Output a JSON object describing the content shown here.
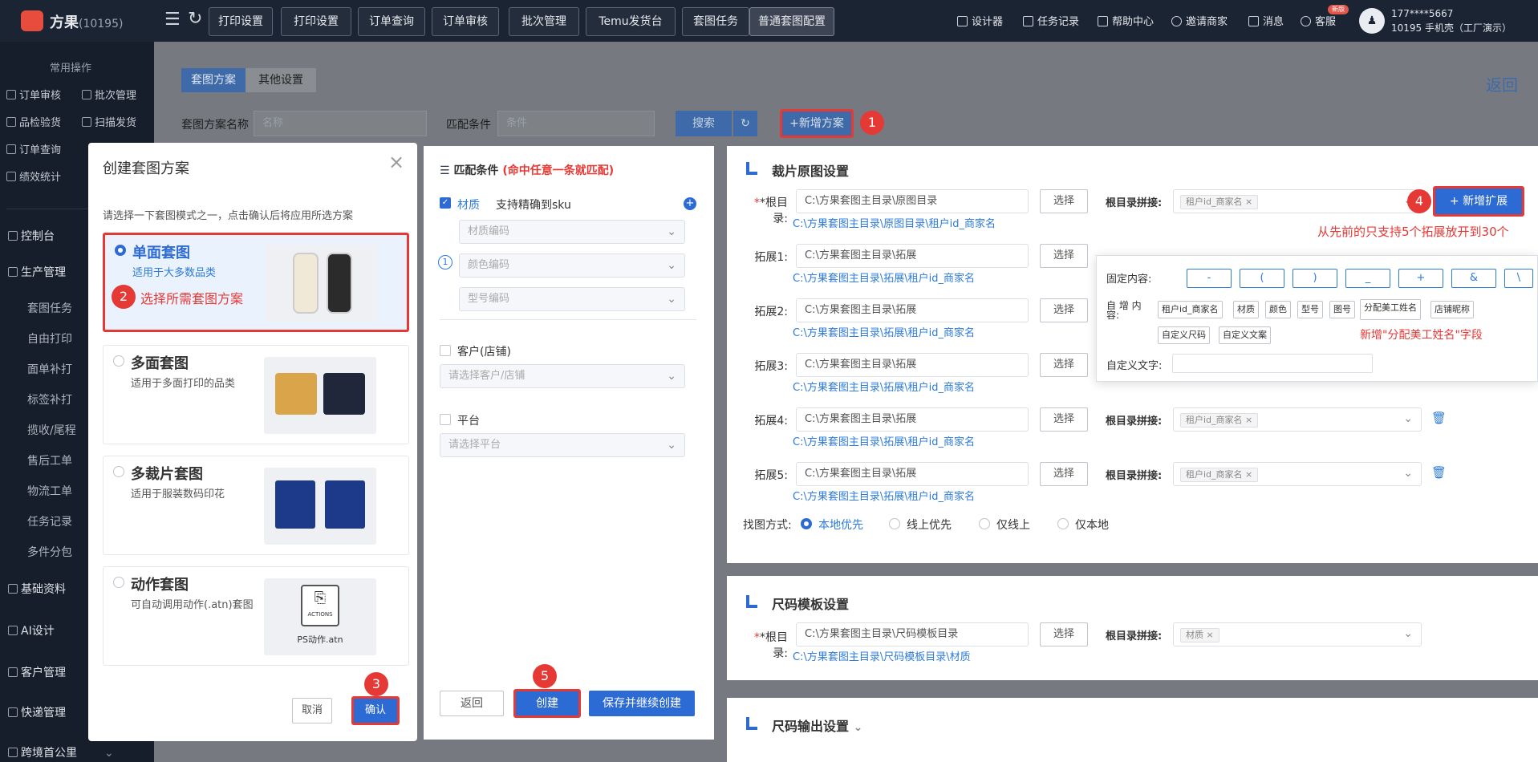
{
  "topbar": {
    "brand": "方果",
    "brand_id": "(10195)",
    "tabs": [
      "打印设置",
      "打印设置",
      "订单查询",
      "订单审核",
      "批次管理",
      "Temu发货台",
      "套图任务",
      "普通套图配置"
    ],
    "right": [
      "设计器",
      "任务记录",
      "帮助中心",
      "邀请商家",
      "消息",
      "客服"
    ],
    "badge": "新版",
    "user_phone": "177****5667",
    "user_sub": "10195 手机壳（工厂演示）"
  },
  "sidebar": {
    "common_header": "常用操作",
    "quick": [
      "订单审核",
      "批次管理",
      "品检验货",
      "扫描发货",
      "订单查询",
      "",
      "绩效统计",
      ""
    ],
    "menu": [
      "控制台",
      "生产管理",
      "基础资料",
      "AI设计",
      "客户管理",
      "快递管理",
      "跨境首公里"
    ],
    "sub": [
      "套图任务",
      "自由打印",
      "面单补打",
      "标签补打",
      "揽收/尾程",
      "售后工单",
      "物流工单",
      "任务记录",
      "多件分包"
    ]
  },
  "main": {
    "tab_scheme": "套图方案",
    "tab_other": "其他设置",
    "back": "返回",
    "name_label": "套图方案名称",
    "name_placeholder": "名称",
    "cond_label": "匹配条件",
    "cond_placeholder": "条件",
    "search": "搜索",
    "add_scheme": "+新增方案"
  },
  "match": {
    "title": "匹配条件",
    "note": "(命中任意一条就匹配)",
    "material": "材质",
    "sku": "支持精确到sku",
    "material_code": "材质编码",
    "color_code": "颜色编码",
    "model_code": "型号编码",
    "customer": "客户(店铺)",
    "customer_ph": "请选择客户/店铺",
    "platform": "平台",
    "platform_ph": "请选择平台",
    "back": "返回",
    "create": "创建",
    "save_continue": "保存并继续创建"
  },
  "crop": {
    "title": "裁片原图设置",
    "root_label": "*根目录:",
    "root_value": "C:\\方果套图主目录\\原图目录",
    "root_path": "C:\\方果套图主目录\\原图目录\\租户id_商家名",
    "select": "选择",
    "splice_label": "根目录拼接:",
    "tag": "租户id_商家名",
    "add_ext": "+ 新增扩展",
    "ext_note": "从先前的只支持5个拓展放开到30个",
    "exts": [
      {
        "label": "拓展1:",
        "value": "C:\\方果套图主目录\\拓展",
        "path": "C:\\方果套图主目录\\拓展\\租户id_商家名"
      },
      {
        "label": "拓展2:",
        "value": "C:\\方果套图主目录\\拓展",
        "path": "C:\\方果套图主目录\\拓展\\租户id_商家名"
      },
      {
        "label": "拓展3:",
        "value": "C:\\方果套图主目录\\拓展",
        "path": "C:\\方果套图主目录\\拓展\\租户id_商家名"
      },
      {
        "label": "拓展4:",
        "value": "C:\\方果套图主目录\\拓展",
        "path": "C:\\方果套图主目录\\拓展\\租户id_商家名"
      },
      {
        "label": "拓展5:",
        "value": "C:\\方果套图主目录\\拓展",
        "path": "C:\\方果套图主目录\\拓展\\租户id_商家名"
      }
    ],
    "find_label": "找图方式:",
    "find_opts": [
      "本地优先",
      "线上优先",
      "仅线上",
      "仅本地"
    ]
  },
  "popover": {
    "fixed_label": "固定内容:",
    "fixed": [
      "-",
      "(",
      ")",
      "_",
      "+",
      "&",
      "\\"
    ],
    "auto_label": "自 增 内 容:",
    "auto": [
      "租户id_商家名",
      "材质",
      "颜色",
      "型号",
      "图号",
      "分配美工姓名",
      "店铺昵称",
      "自定义尺码",
      "自定义文案"
    ],
    "auto_note": "新增\"分配美工姓名\"字段",
    "custom_label": "自定义文字:"
  },
  "size": {
    "title": "尺码模板设置",
    "root_label": "*根目录:",
    "root_value": "C:\\方果套图主目录\\尺码模板目录",
    "path": "C:\\方果套图主目录\\尺码模板目录\\材质",
    "select": "选择",
    "splice_label": "根目录拼接:",
    "tag": "材质",
    "output_title": "尺码输出设置"
  },
  "dialog": {
    "title": "创建套图方案",
    "hint": "请选择一下套图模式之一，点击确认后将应用所选方案",
    "opts": [
      {
        "title": "单面套图",
        "desc": "适用于大多数品类"
      },
      {
        "title": "多面套图",
        "desc": "适用于多面打印的品类"
      },
      {
        "title": "多裁片套图",
        "desc": "适用于服装数码印花"
      },
      {
        "title": "动作套图",
        "desc": "可自动调用动作(.atn)套图"
      }
    ],
    "note2": "选择所需套图方案",
    "actions_label": "ACTIONS",
    "actions_file": "PS动作.atn",
    "cancel": "取消",
    "confirm": "确认"
  },
  "steps": [
    "1",
    "2",
    "3",
    "4",
    "5"
  ]
}
